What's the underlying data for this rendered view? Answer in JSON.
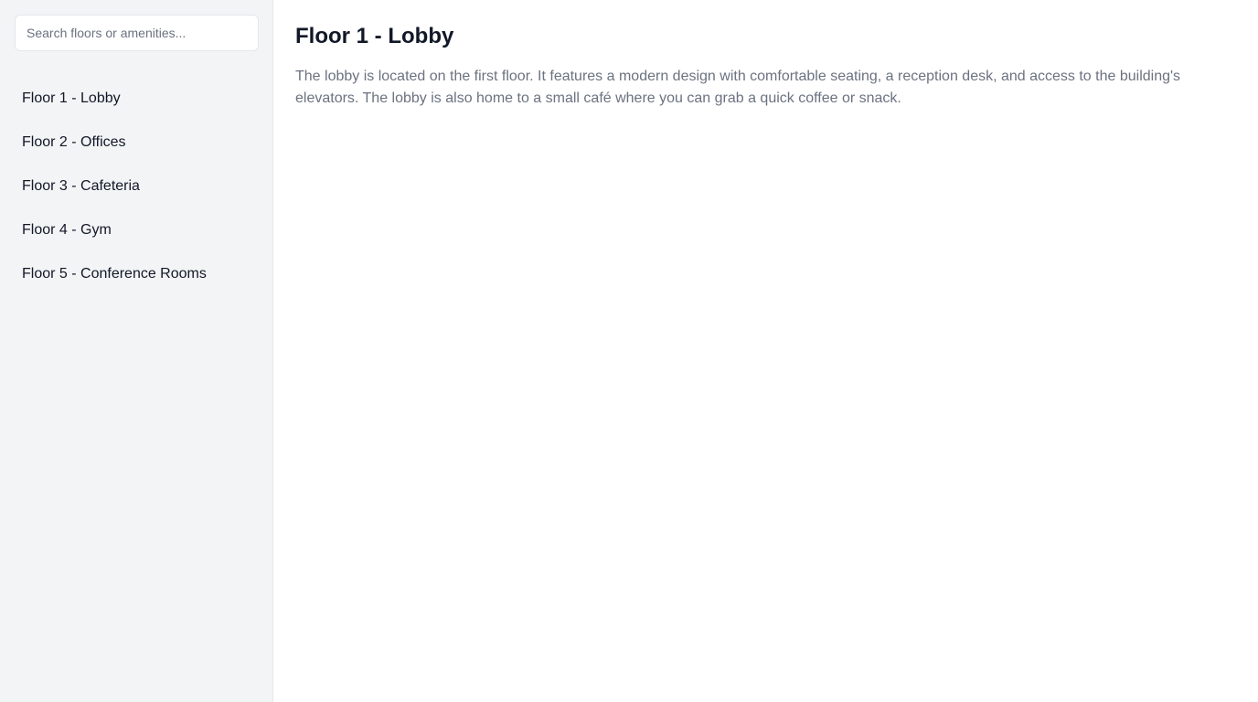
{
  "sidebar": {
    "search": {
      "placeholder": "Search floors or amenities...",
      "value": ""
    },
    "floors": [
      {
        "label": "Floor 1 - Lobby"
      },
      {
        "label": "Floor 2 - Offices"
      },
      {
        "label": "Floor 3 - Cafeteria"
      },
      {
        "label": "Floor 4 - Gym"
      },
      {
        "label": "Floor 5 - Conference Rooms"
      }
    ]
  },
  "main": {
    "title": "Floor 1 - Lobby",
    "description": "The lobby is located on the first floor. It features a modern design with comfortable seating, a reception desk, and access to the building's elevators. The lobby is also home to a small café where you can grab a quick coffee or snack."
  },
  "colors": {
    "sidebar_bg": "#f3f4f6",
    "text_primary": "#111827",
    "text_secondary": "#6b7280",
    "border": "#e5e7eb"
  }
}
